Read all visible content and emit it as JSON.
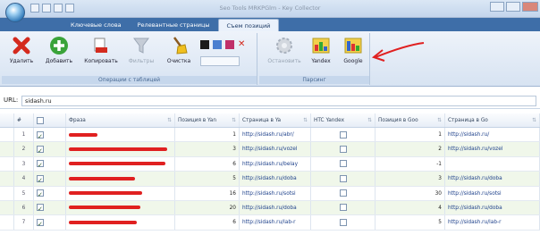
{
  "window": {
    "title": "Seo Tools MRKPGlm - Key Collector"
  },
  "ribbon": {
    "tabs": [
      {
        "label": "Ключевые слова"
      },
      {
        "label": "Релевантные страницы"
      },
      {
        "label": "Съем позиций"
      }
    ],
    "active_tab": 2,
    "groups": {
      "table_ops": {
        "label": "Операции с таблицей",
        "buttons": [
          {
            "label": "Удалить",
            "icon": "delete-x-icon"
          },
          {
            "label": "Добавить",
            "icon": "add-plus-icon"
          },
          {
            "label": "Копировать",
            "icon": "copy-icon"
          },
          {
            "label": "Фильтры",
            "icon": "filter-icon"
          },
          {
            "label": "Очистка",
            "icon": "broom-icon"
          }
        ]
      },
      "parsing": {
        "label": "Парсинг",
        "buttons": [
          {
            "label": "Остановить",
            "icon": "stop-gear-icon"
          },
          {
            "label": "Yandex",
            "icon": "yandex-chart-icon"
          },
          {
            "label": "Google",
            "icon": "google-chart-icon"
          }
        ]
      }
    }
  },
  "url_bar": {
    "label": "URL:",
    "value": "sidash.ru"
  },
  "table": {
    "columns": [
      "#",
      "",
      "Фраза",
      "Позиция в Yan",
      "Страница в Ya",
      "HTC Yandex",
      "Позиция в Goo",
      "Страница в Go"
    ],
    "rows": [
      {
        "n": "1",
        "pos_y": "1",
        "page_y": "http://sidash.ru/abr/",
        "pos_g": "1",
        "page_g": "http://sidash.ru/"
      },
      {
        "n": "2",
        "pos_y": "3",
        "page_y": "http://sidash.ru/vozel",
        "pos_g": "2",
        "page_g": "http://sidash.ru/vozel"
      },
      {
        "n": "3",
        "pos_y": "6",
        "page_y": "http://sidash.ru/belay",
        "pos_g": "-1",
        "page_g": ""
      },
      {
        "n": "4",
        "pos_y": "5",
        "page_y": "http://sidash.ru/doba",
        "pos_g": "3",
        "page_g": "http://sidash.ru/doba"
      },
      {
        "n": "5",
        "pos_y": "16",
        "page_y": "http://sidash.ru/sotsi",
        "pos_g": "30",
        "page_g": "http://sidash.ru/sotsi"
      },
      {
        "n": "6",
        "pos_y": "20",
        "page_y": "http://sidash.ru/doba",
        "pos_g": "4",
        "page_g": "http://sidash.ru/doba"
      },
      {
        "n": "7",
        "pos_y": "6",
        "page_y": "http://sidash.ru/lab-r",
        "pos_g": "5",
        "page_g": "http://sidash.ru/lab-r"
      }
    ]
  },
  "colors": {
    "tab_strip": "#3e6ea8",
    "annotation_arrow": "#e02020",
    "redaction": "#e02020",
    "even_row": "#f0f7ea"
  }
}
